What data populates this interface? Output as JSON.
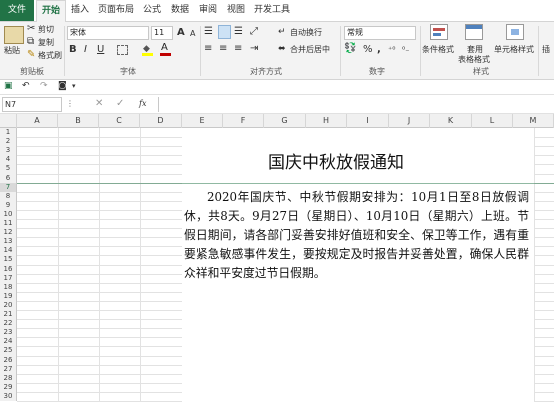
{
  "tabs": [
    "文件",
    "开始",
    "插入",
    "页面布局",
    "公式",
    "数据",
    "审阅",
    "视图",
    "开发工具"
  ],
  "clipboard": {
    "paste": "粘贴",
    "cut": "剪切",
    "copy": "复制",
    "painter": "格式刷",
    "label": "剪贴板"
  },
  "font": {
    "name": "宋体",
    "size": "11",
    "label": "字体",
    "bold": "B",
    "italic": "I",
    "underline": "U",
    "grow": "A",
    "shrink": "A"
  },
  "align": {
    "wrap": "自动换行",
    "merge": "合并后居中",
    "label": "对齐方式"
  },
  "number": {
    "format": "常规",
    "label": "数字",
    "percent": "%",
    "comma": ","
  },
  "styles": {
    "conditional": "条件格式",
    "table1": "套用",
    "table2": "表格格式",
    "cell": "单元格样式",
    "label": "样式"
  },
  "insert": {
    "label": "插"
  },
  "namebox": "N7",
  "fx": "fx",
  "columns": [
    "A",
    "B",
    "C",
    "D",
    "E",
    "F",
    "G",
    "H",
    "I",
    "J",
    "K",
    "L",
    "M"
  ],
  "rows": [
    "1",
    "2",
    "3",
    "4",
    "5",
    "6",
    "7",
    "8",
    "9",
    "10",
    "11",
    "12",
    "13",
    "14",
    "15",
    "16",
    "17",
    "18",
    "19",
    "20",
    "21",
    "22",
    "23",
    "24",
    "25",
    "26",
    "27",
    "28",
    "29",
    "30"
  ],
  "document": {
    "title": "国庆中秋放假通知",
    "body": "2020年国庆节、中秋节假期安排为：10月1日至8日放假调休，共8天。9月27日（星期日）、10月10日（星期六）上班。节假日期间，请各部门妥善安排好值班和安全、保卫等工作，遇有重要紧急敏感事件发生，要按规定及时报告并妥善处置，确保人民群众祥和平安度过节日假期。"
  },
  "colors": {
    "excel_green": "#217346",
    "font_red": "#c00000",
    "fill_yellow": "#ffff00"
  }
}
